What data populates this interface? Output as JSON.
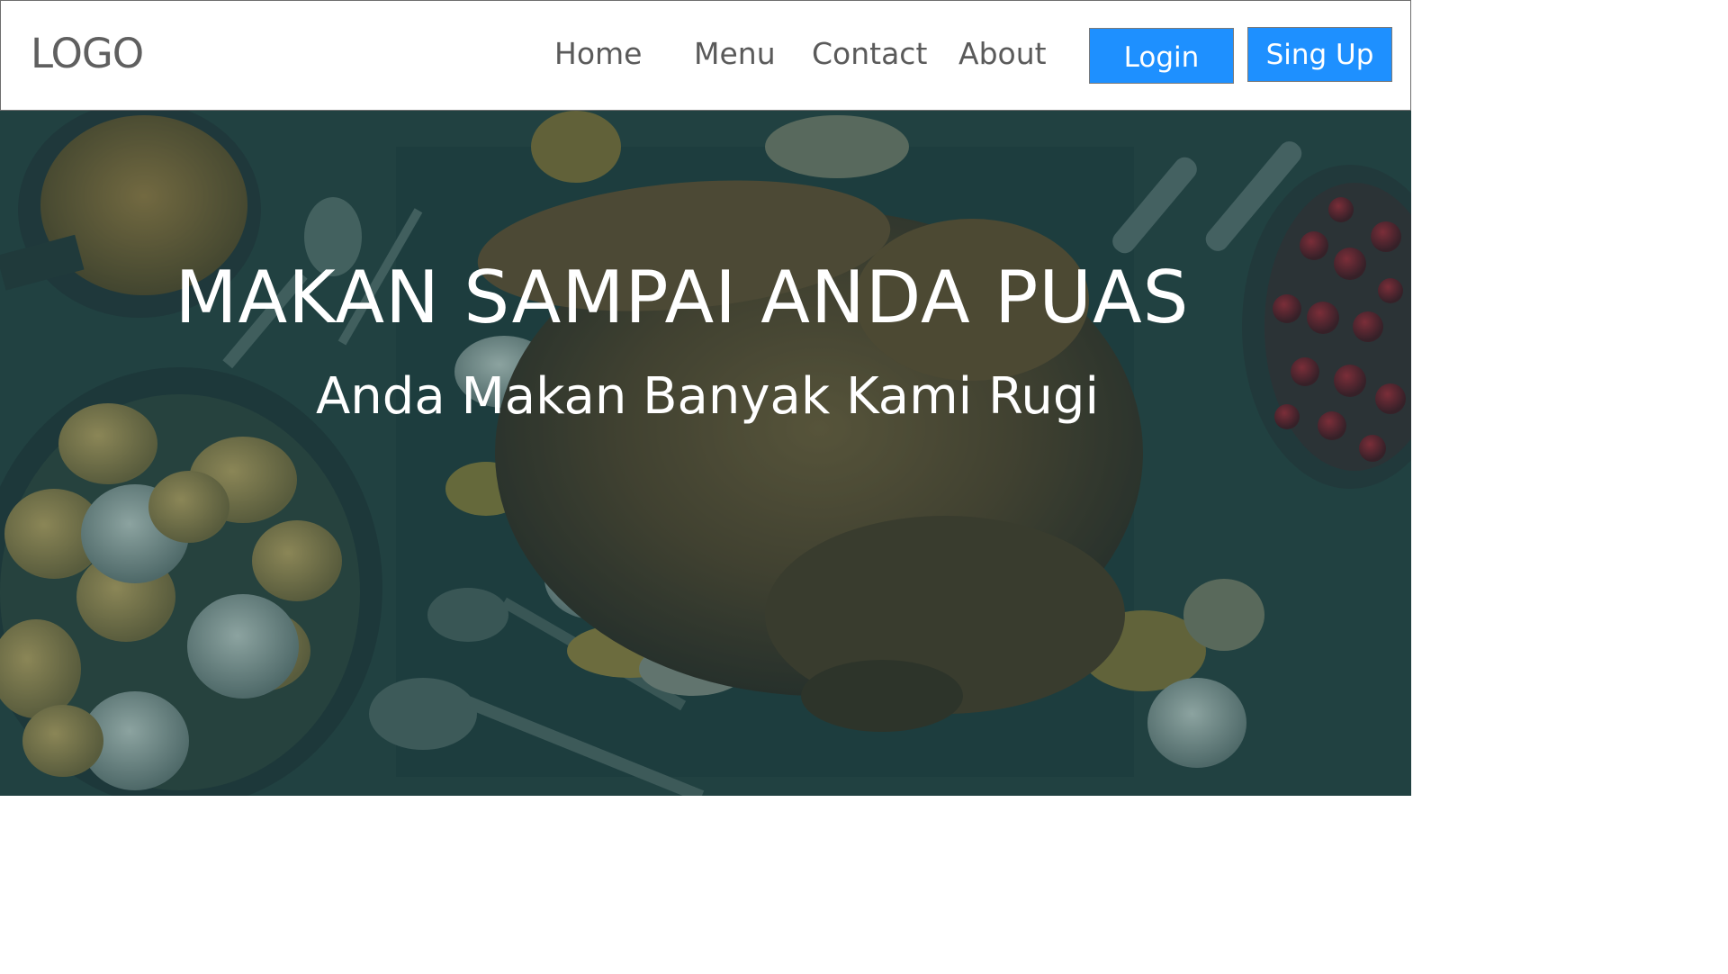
{
  "navbar": {
    "logo": "LOGO",
    "links": [
      {
        "label": "Home"
      },
      {
        "label": "Menu"
      },
      {
        "label": "Contact"
      },
      {
        "label": "About"
      }
    ],
    "login_label": "Login",
    "signup_label": "Sing Up"
  },
  "hero": {
    "title": "MAKAN SAMPAI ANDA PUAS",
    "subtitle": "Anda Makan Banyak Kami Rugi",
    "background": "roasted-turkey-feast-photo"
  },
  "colors": {
    "button_bg": "#1e90ff",
    "button_text": "#ffffff",
    "nav_text": "#5a5a5a",
    "hero_overlay": "#0c4650"
  }
}
